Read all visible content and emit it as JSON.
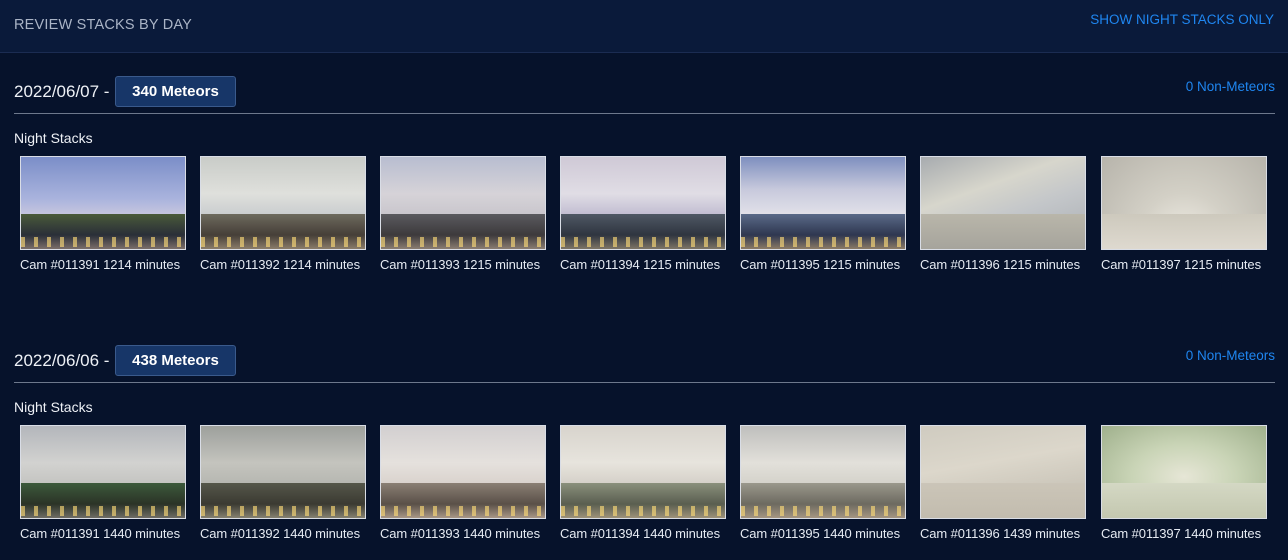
{
  "header": {
    "title": "REVIEW STACKS BY DAY",
    "night_link": "SHOW NIGHT STACKS ONLY"
  },
  "days": [
    {
      "date": "2022/06/07 -",
      "meteors": "340 Meteors",
      "non_meteors": "0 Non-Meteors",
      "stacks_label": "Night Stacks",
      "thumbs": [
        {
          "caption": "Cam #011391 1214 minutes"
        },
        {
          "caption": "Cam #011392 1214 minutes"
        },
        {
          "caption": "Cam #011393 1215 minutes"
        },
        {
          "caption": "Cam #011394 1215 minutes"
        },
        {
          "caption": "Cam #011395 1215 minutes"
        },
        {
          "caption": "Cam #011396 1215 minutes"
        },
        {
          "caption": "Cam #011397 1215 minutes"
        }
      ]
    },
    {
      "date": "2022/06/06 -",
      "meteors": "438 Meteors",
      "non_meteors": "0 Non-Meteors",
      "stacks_label": "Night Stacks",
      "thumbs": [
        {
          "caption": "Cam #011391 1440 minutes"
        },
        {
          "caption": "Cam #011392 1440 minutes"
        },
        {
          "caption": "Cam #011393 1440 minutes"
        },
        {
          "caption": "Cam #011394 1440 minutes"
        },
        {
          "caption": "Cam #011395 1440 minutes"
        },
        {
          "caption": "Cam #011396 1439 minutes"
        },
        {
          "caption": "Cam #011397 1440 minutes"
        }
      ]
    }
  ]
}
